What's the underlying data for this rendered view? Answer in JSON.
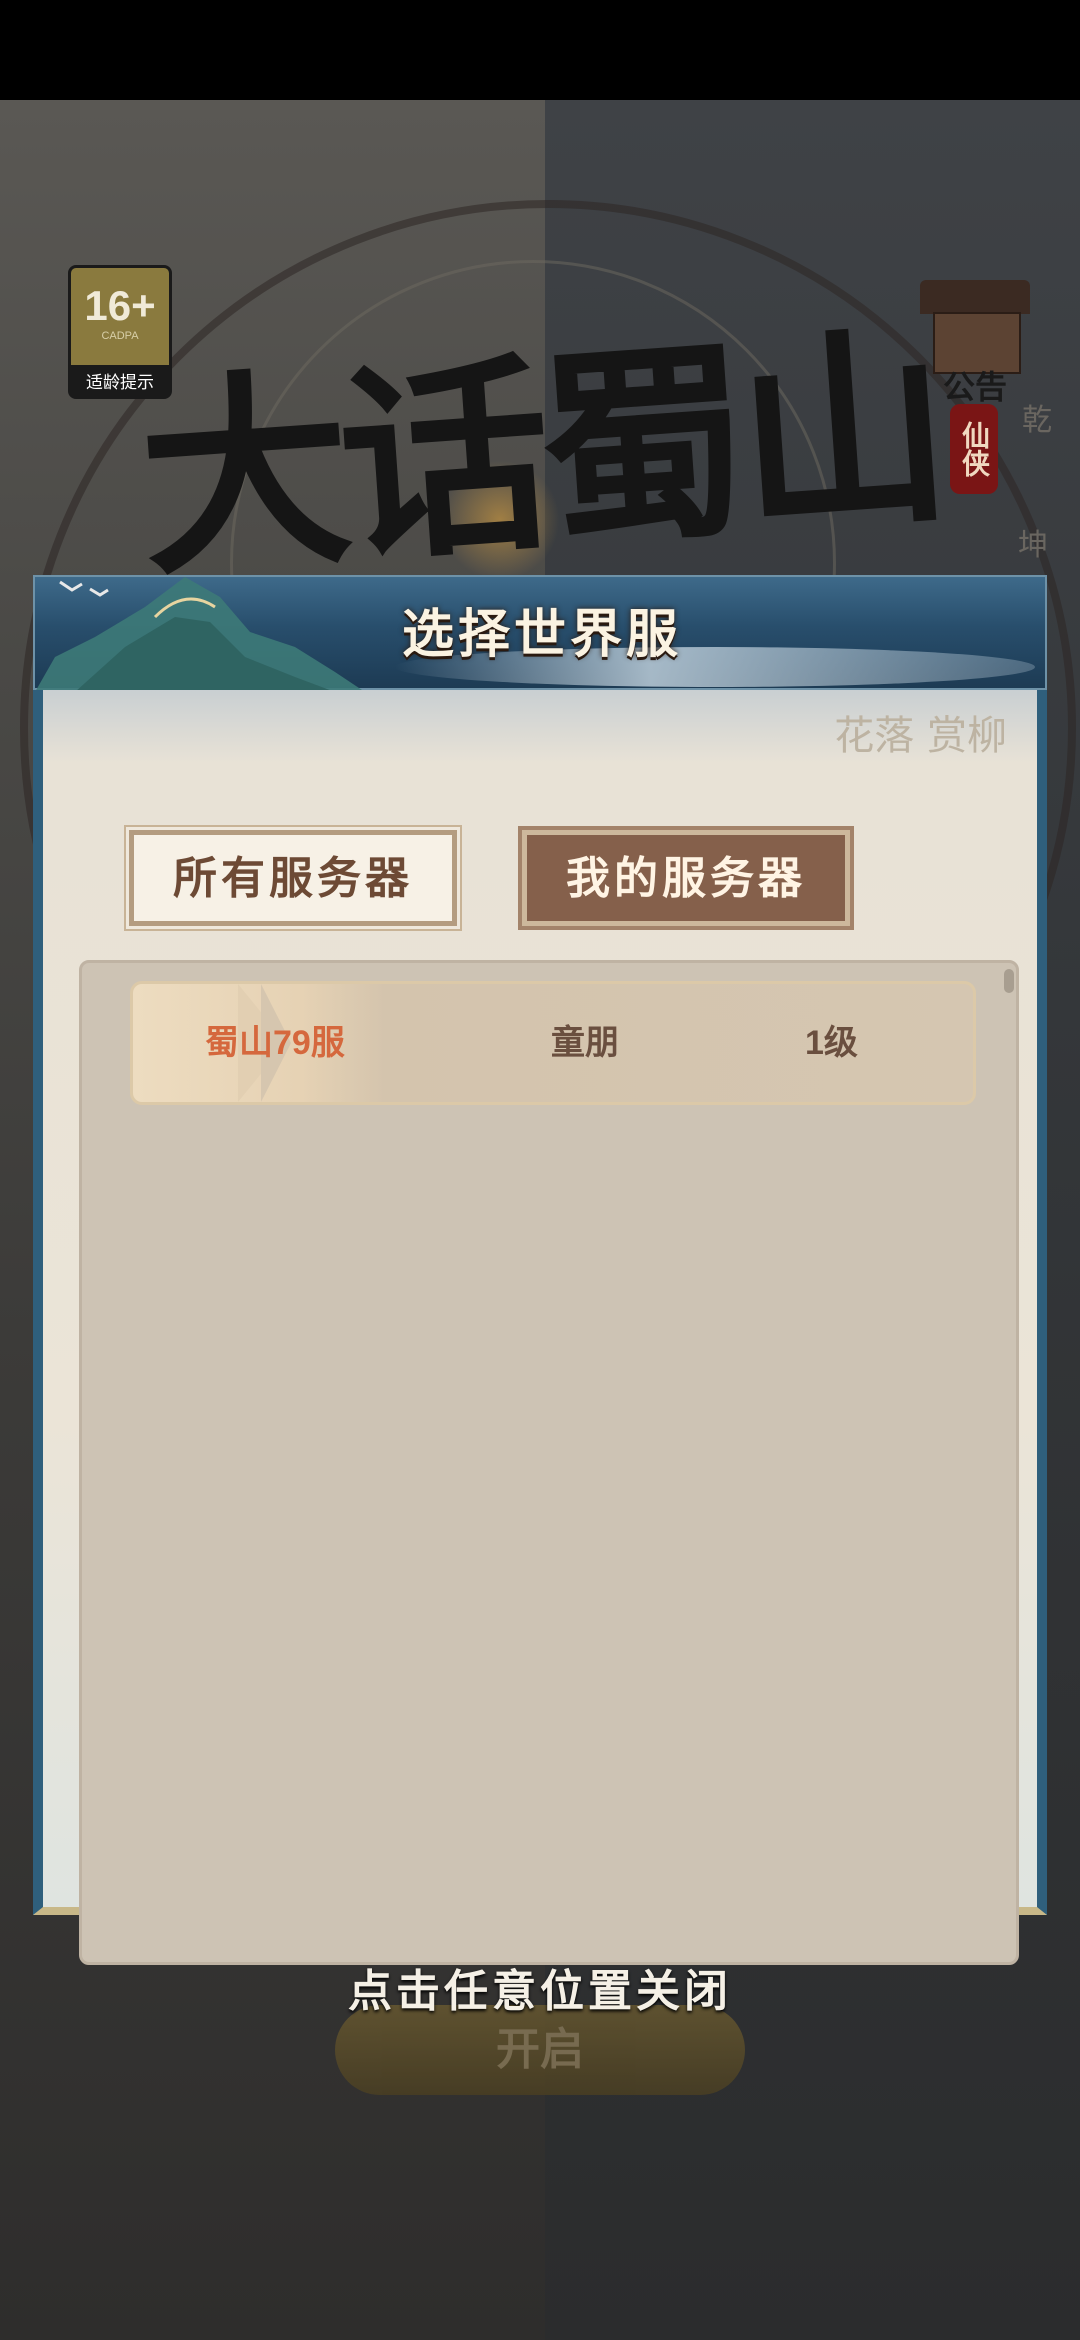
{
  "background": {
    "game_title": "大话蜀山",
    "age_rating": {
      "number": "16+",
      "org": "CADPA",
      "label": "适龄提示"
    },
    "notice": {
      "label": "公告",
      "tag": "仙侠"
    },
    "side_chars": [
      "乾",
      "坤"
    ],
    "start_button": "开启"
  },
  "dialog": {
    "title": "选择世界服",
    "decor_text": "花落 赏柳",
    "tabs": [
      {
        "label": "所有服务器",
        "selected": false
      },
      {
        "label": "我的服务器",
        "selected": true
      }
    ],
    "servers": [
      {
        "name": "蜀山79服",
        "role": "童朋",
        "level": "1级"
      }
    ]
  },
  "close_hint": "点击任意位置关闭",
  "colors": {
    "header": "#284e6c",
    "tab_selected": "#85604b",
    "server_name": "#d5683d",
    "list_bg": "#cdc3b4"
  }
}
